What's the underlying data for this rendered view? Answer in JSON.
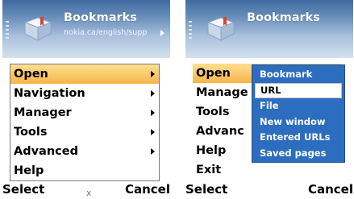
{
  "left_screen": {
    "title": "Bookmarks",
    "subtitle": "nokia.ca/english/supp",
    "menu": [
      {
        "label": "Open",
        "submenu": true,
        "selected": true
      },
      {
        "label": "Navigation",
        "submenu": true
      },
      {
        "label": "Manager",
        "submenu": true
      },
      {
        "label": "Tools",
        "submenu": true
      },
      {
        "label": "Advanced",
        "submenu": true
      },
      {
        "label": "Help",
        "submenu": false
      }
    ],
    "softkeys": {
      "left": "Select",
      "middle": "x",
      "right": "Cancel"
    }
  },
  "right_screen": {
    "title": "Bookmarks",
    "menu": [
      {
        "label": "Open",
        "selected": true
      },
      {
        "label": "Manage"
      },
      {
        "label": "Tools"
      },
      {
        "label": "Advanc"
      },
      {
        "label": "Help"
      },
      {
        "label": "Exit"
      }
    ],
    "submenu": [
      {
        "label": "Bookmark"
      },
      {
        "label": "URL",
        "selected": true
      },
      {
        "label": "File"
      },
      {
        "label": "New window"
      },
      {
        "label": "Entered URLs"
      },
      {
        "label": "Saved pages"
      }
    ],
    "softkeys": {
      "left": "Select",
      "right": "Cancel"
    }
  },
  "colors": {
    "title_gradient_top": "#3f6aa0",
    "highlight": "#f6b54a",
    "submenu_bg": "#2c6dbf"
  },
  "icons": {
    "app_icon": "bookmarks-app-icon",
    "submenu_arrow": "chevron-right-icon"
  }
}
